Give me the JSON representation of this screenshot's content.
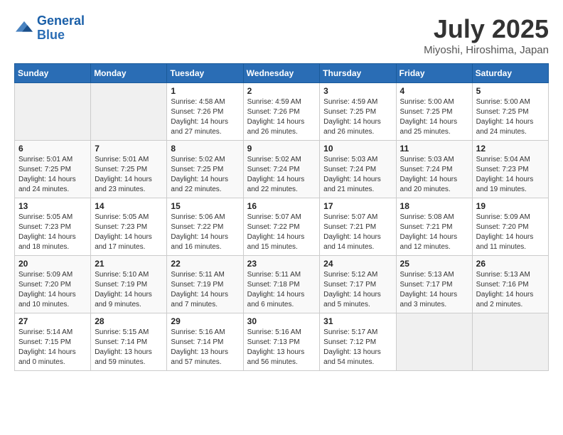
{
  "header": {
    "logo_line1": "General",
    "logo_line2": "Blue",
    "month": "July 2025",
    "location": "Miyoshi, Hiroshima, Japan"
  },
  "weekdays": [
    "Sunday",
    "Monday",
    "Tuesday",
    "Wednesday",
    "Thursday",
    "Friday",
    "Saturday"
  ],
  "weeks": [
    [
      {
        "day": "",
        "sunrise": "",
        "sunset": "",
        "daylight": ""
      },
      {
        "day": "",
        "sunrise": "",
        "sunset": "",
        "daylight": ""
      },
      {
        "day": "1",
        "sunrise": "Sunrise: 4:58 AM",
        "sunset": "Sunset: 7:26 PM",
        "daylight": "Daylight: 14 hours and 27 minutes."
      },
      {
        "day": "2",
        "sunrise": "Sunrise: 4:59 AM",
        "sunset": "Sunset: 7:26 PM",
        "daylight": "Daylight: 14 hours and 26 minutes."
      },
      {
        "day": "3",
        "sunrise": "Sunrise: 4:59 AM",
        "sunset": "Sunset: 7:25 PM",
        "daylight": "Daylight: 14 hours and 26 minutes."
      },
      {
        "day": "4",
        "sunrise": "Sunrise: 5:00 AM",
        "sunset": "Sunset: 7:25 PM",
        "daylight": "Daylight: 14 hours and 25 minutes."
      },
      {
        "day": "5",
        "sunrise": "Sunrise: 5:00 AM",
        "sunset": "Sunset: 7:25 PM",
        "daylight": "Daylight: 14 hours and 24 minutes."
      }
    ],
    [
      {
        "day": "6",
        "sunrise": "Sunrise: 5:01 AM",
        "sunset": "Sunset: 7:25 PM",
        "daylight": "Daylight: 14 hours and 24 minutes."
      },
      {
        "day": "7",
        "sunrise": "Sunrise: 5:01 AM",
        "sunset": "Sunset: 7:25 PM",
        "daylight": "Daylight: 14 hours and 23 minutes."
      },
      {
        "day": "8",
        "sunrise": "Sunrise: 5:02 AM",
        "sunset": "Sunset: 7:25 PM",
        "daylight": "Daylight: 14 hours and 22 minutes."
      },
      {
        "day": "9",
        "sunrise": "Sunrise: 5:02 AM",
        "sunset": "Sunset: 7:24 PM",
        "daylight": "Daylight: 14 hours and 22 minutes."
      },
      {
        "day": "10",
        "sunrise": "Sunrise: 5:03 AM",
        "sunset": "Sunset: 7:24 PM",
        "daylight": "Daylight: 14 hours and 21 minutes."
      },
      {
        "day": "11",
        "sunrise": "Sunrise: 5:03 AM",
        "sunset": "Sunset: 7:24 PM",
        "daylight": "Daylight: 14 hours and 20 minutes."
      },
      {
        "day": "12",
        "sunrise": "Sunrise: 5:04 AM",
        "sunset": "Sunset: 7:23 PM",
        "daylight": "Daylight: 14 hours and 19 minutes."
      }
    ],
    [
      {
        "day": "13",
        "sunrise": "Sunrise: 5:05 AM",
        "sunset": "Sunset: 7:23 PM",
        "daylight": "Daylight: 14 hours and 18 minutes."
      },
      {
        "day": "14",
        "sunrise": "Sunrise: 5:05 AM",
        "sunset": "Sunset: 7:23 PM",
        "daylight": "Daylight: 14 hours and 17 minutes."
      },
      {
        "day": "15",
        "sunrise": "Sunrise: 5:06 AM",
        "sunset": "Sunset: 7:22 PM",
        "daylight": "Daylight: 14 hours and 16 minutes."
      },
      {
        "day": "16",
        "sunrise": "Sunrise: 5:07 AM",
        "sunset": "Sunset: 7:22 PM",
        "daylight": "Daylight: 14 hours and 15 minutes."
      },
      {
        "day": "17",
        "sunrise": "Sunrise: 5:07 AM",
        "sunset": "Sunset: 7:21 PM",
        "daylight": "Daylight: 14 hours and 14 minutes."
      },
      {
        "day": "18",
        "sunrise": "Sunrise: 5:08 AM",
        "sunset": "Sunset: 7:21 PM",
        "daylight": "Daylight: 14 hours and 12 minutes."
      },
      {
        "day": "19",
        "sunrise": "Sunrise: 5:09 AM",
        "sunset": "Sunset: 7:20 PM",
        "daylight": "Daylight: 14 hours and 11 minutes."
      }
    ],
    [
      {
        "day": "20",
        "sunrise": "Sunrise: 5:09 AM",
        "sunset": "Sunset: 7:20 PM",
        "daylight": "Daylight: 14 hours and 10 minutes."
      },
      {
        "day": "21",
        "sunrise": "Sunrise: 5:10 AM",
        "sunset": "Sunset: 7:19 PM",
        "daylight": "Daylight: 14 hours and 9 minutes."
      },
      {
        "day": "22",
        "sunrise": "Sunrise: 5:11 AM",
        "sunset": "Sunset: 7:19 PM",
        "daylight": "Daylight: 14 hours and 7 minutes."
      },
      {
        "day": "23",
        "sunrise": "Sunrise: 5:11 AM",
        "sunset": "Sunset: 7:18 PM",
        "daylight": "Daylight: 14 hours and 6 minutes."
      },
      {
        "day": "24",
        "sunrise": "Sunrise: 5:12 AM",
        "sunset": "Sunset: 7:17 PM",
        "daylight": "Daylight: 14 hours and 5 minutes."
      },
      {
        "day": "25",
        "sunrise": "Sunrise: 5:13 AM",
        "sunset": "Sunset: 7:17 PM",
        "daylight": "Daylight: 14 hours and 3 minutes."
      },
      {
        "day": "26",
        "sunrise": "Sunrise: 5:13 AM",
        "sunset": "Sunset: 7:16 PM",
        "daylight": "Daylight: 14 hours and 2 minutes."
      }
    ],
    [
      {
        "day": "27",
        "sunrise": "Sunrise: 5:14 AM",
        "sunset": "Sunset: 7:15 PM",
        "daylight": "Daylight: 14 hours and 0 minutes."
      },
      {
        "day": "28",
        "sunrise": "Sunrise: 5:15 AM",
        "sunset": "Sunset: 7:14 PM",
        "daylight": "Daylight: 13 hours and 59 minutes."
      },
      {
        "day": "29",
        "sunrise": "Sunrise: 5:16 AM",
        "sunset": "Sunset: 7:14 PM",
        "daylight": "Daylight: 13 hours and 57 minutes."
      },
      {
        "day": "30",
        "sunrise": "Sunrise: 5:16 AM",
        "sunset": "Sunset: 7:13 PM",
        "daylight": "Daylight: 13 hours and 56 minutes."
      },
      {
        "day": "31",
        "sunrise": "Sunrise: 5:17 AM",
        "sunset": "Sunset: 7:12 PM",
        "daylight": "Daylight: 13 hours and 54 minutes."
      },
      {
        "day": "",
        "sunrise": "",
        "sunset": "",
        "daylight": ""
      },
      {
        "day": "",
        "sunrise": "",
        "sunset": "",
        "daylight": ""
      }
    ]
  ]
}
